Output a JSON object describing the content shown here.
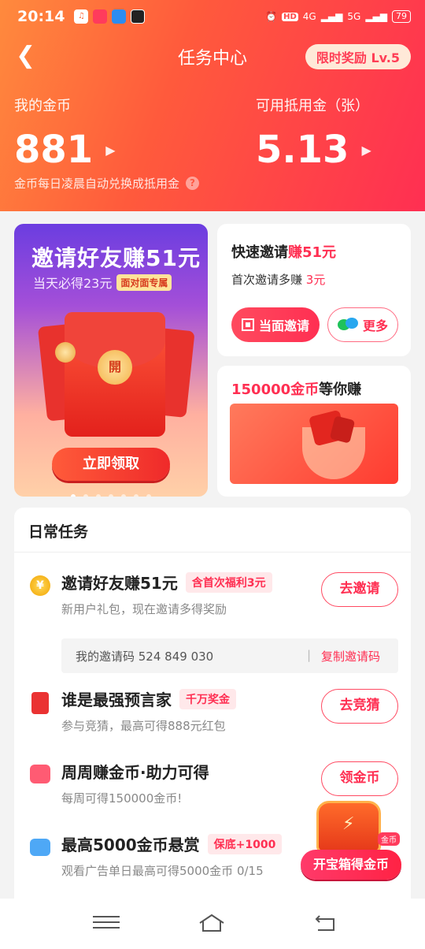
{
  "status_bar": {
    "time": "20:14",
    "network": "4G",
    "network2": "5G",
    "battery": "79",
    "hd": "HD"
  },
  "nav": {
    "title": "任务中心",
    "badge": "限时奖励 Lv.5"
  },
  "balances": {
    "coins_label": "我的金币",
    "coins_value": "881",
    "voucher_label": "可用抵用金（张）",
    "voucher_value": "5.13",
    "note": "金币每日凌晨自动兑换成抵用金"
  },
  "banner": {
    "title": "邀请好友赚51元",
    "subtitle": "当天必得23元",
    "tag": "面对面专属",
    "seal": "開",
    "button": "立即领取",
    "slide_count": 7,
    "active_slide": 0
  },
  "quick_invite": {
    "title_prefix": "快速邀请",
    "title_highlight": "赚51元",
    "subtitle_prefix": "首次邀请多赚",
    "subtitle_highlight": "3元",
    "face_button": "当面邀请",
    "more_button": "更多"
  },
  "coin_promo": {
    "title_highlight": "150000金币",
    "title_suffix": "等你赚"
  },
  "daily": {
    "heading": "日常任务",
    "tasks": [
      {
        "title": "邀请好友赚51元",
        "tag": "含首次福利3元",
        "desc": "新用户礼包，现在邀请多得奖励",
        "button": "去邀请",
        "icon": "¥"
      },
      {
        "title": "谁是最强预言家",
        "tag": "千万奖金",
        "desc": "参与竞猜，最高可得888元红包",
        "button": "去竞猜"
      },
      {
        "title": "周周赚金币·助力可得",
        "desc": "每周可得150000金币!",
        "button": "领金币"
      },
      {
        "title": "最高5000金币悬赏",
        "tag": "保底+1000",
        "desc": "观看广告单日最高可得5000金币 0/15"
      }
    ],
    "invite_code_label": "我的邀请码 524 849 030",
    "invite_divider": "|",
    "copy_button": "复制邀请码"
  },
  "treasure": {
    "button": "开宝箱得金币",
    "tag": "金币"
  }
}
